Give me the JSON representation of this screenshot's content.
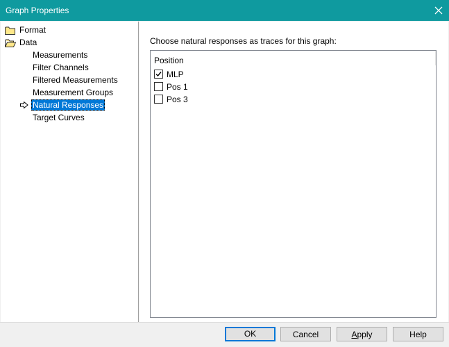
{
  "window": {
    "title": "Graph Properties"
  },
  "tree": {
    "format_label": "Format",
    "data_label": "Data",
    "children": [
      {
        "label": "Measurements"
      },
      {
        "label": "Filter Channels"
      },
      {
        "label": "Filtered Measurements"
      },
      {
        "label": "Measurement Groups"
      },
      {
        "label": "Natural Responses"
      },
      {
        "label": "Target Curves"
      }
    ],
    "selected": "Natural Responses"
  },
  "panel": {
    "prompt": "Choose natural responses as traces for this graph:",
    "column_header": "Position",
    "items": [
      {
        "label": "MLP",
        "checked": true
      },
      {
        "label": "Pos 1",
        "checked": false
      },
      {
        "label": "Pos 3",
        "checked": false
      }
    ]
  },
  "buttons": {
    "ok": "OK",
    "cancel": "Cancel",
    "apply": "Apply",
    "help": "Help"
  },
  "colors": {
    "titlebar": "#0f9a9f",
    "selection": "#0078d7"
  }
}
